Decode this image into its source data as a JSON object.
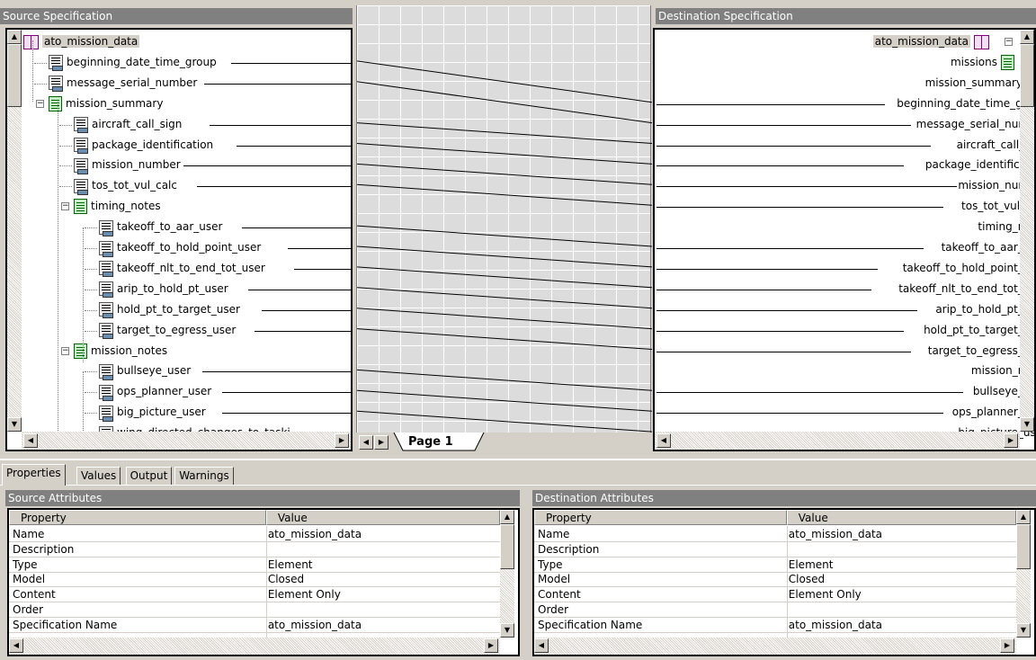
{
  "source_panel": {
    "title": "Source Specification",
    "items": [
      {
        "label": "ato_mission_data",
        "icon": "book-icon"
      },
      {
        "label": "beginning_date_time_group",
        "icon": "leaf-icon"
      },
      {
        "label": "message_serial_number",
        "icon": "leaf-icon"
      },
      {
        "label": "mission_summary",
        "icon": "node-icon"
      },
      {
        "label": "aircraft_call_sign",
        "icon": "leaf-icon"
      },
      {
        "label": "package_identification",
        "icon": "leaf-icon"
      },
      {
        "label": "mission_number",
        "icon": "leaf-icon"
      },
      {
        "label": "tos_tot_vul_calc",
        "icon": "leaf-icon"
      },
      {
        "label": "timing_notes",
        "icon": "node-icon"
      },
      {
        "label": "takeoff_to_aar_user",
        "icon": "leaf-icon"
      },
      {
        "label": "takeoff_to_hold_point_user",
        "icon": "leaf-icon"
      },
      {
        "label": "takeoff_nlt_to_end_tot_user",
        "icon": "leaf-icon"
      },
      {
        "label": "arip_to_hold_pt_user",
        "icon": "leaf-icon"
      },
      {
        "label": "hold_pt_to_target_user",
        "icon": "leaf-icon"
      },
      {
        "label": "target_to_egress_user",
        "icon": "leaf-icon"
      },
      {
        "label": "mission_notes",
        "icon": "node-icon"
      },
      {
        "label": "bullseye_user",
        "icon": "leaf-icon"
      },
      {
        "label": "ops_planner_user",
        "icon": "leaf-icon"
      },
      {
        "label": "big_picture_user",
        "icon": "leaf-icon"
      },
      {
        "label": "wing_directed_changes_to_taski",
        "icon": "leaf-icon"
      }
    ]
  },
  "destination_panel": {
    "title": "Destination Specification",
    "items": [
      {
        "label": "ato_mission_data",
        "icon": "book-icon"
      },
      {
        "label": "missions",
        "icon": "node-icon"
      },
      {
        "label": "mission_summary",
        "icon": "node-icon"
      },
      {
        "label": "beginning_date_time_group",
        "icon": "leaf-icon"
      },
      {
        "label": "message_serial_number",
        "icon": "leaf-icon"
      },
      {
        "label": "aircraft_call_sign",
        "icon": "leaf-icon"
      },
      {
        "label": "package_identification",
        "icon": "leaf-icon"
      },
      {
        "label": "mission_number",
        "icon": "leaf-icon"
      },
      {
        "label": "tos_tot_vul_calc",
        "icon": "leaf-icon"
      },
      {
        "label": "timing_notes",
        "icon": "node-icon"
      },
      {
        "label": "takeoff_to_aar_user",
        "icon": "leaf-icon"
      },
      {
        "label": "takeoff_to_hold_point_user",
        "icon": "leaf-icon"
      },
      {
        "label": "takeoff_nlt_to_end_tot_user",
        "icon": "leaf-icon"
      },
      {
        "label": "arip_to_hold_pt_user",
        "icon": "leaf-icon"
      },
      {
        "label": "hold_pt_to_target_user",
        "icon": "leaf-icon"
      },
      {
        "label": "target_to_egress_user",
        "icon": "leaf-icon"
      },
      {
        "label": "mission_notes",
        "icon": "node-icon"
      },
      {
        "label": "bullseye_user",
        "icon": "leaf-icon"
      },
      {
        "label": "ops_planner_user",
        "icon": "leaf-icon"
      },
      {
        "label": "big_picture_user",
        "icon": "leaf-icon"
      }
    ]
  },
  "mapping": {
    "page_tab_label": "Page 1"
  },
  "tabs": [
    "Properties",
    "Values",
    "Output",
    "Warnings"
  ],
  "source_attributes": {
    "title": "Source Attributes",
    "columns": [
      "Property",
      "Value"
    ],
    "rows": [
      [
        "Name",
        "ato_mission_data"
      ],
      [
        "Description",
        ""
      ],
      [
        "Type",
        "Element"
      ],
      [
        "Model",
        "Closed"
      ],
      [
        "Content",
        "Element Only"
      ],
      [
        "Order",
        ""
      ],
      [
        "Specification Name",
        "ato_mission_data"
      ]
    ]
  },
  "destination_attributes": {
    "title": "Destination Attributes",
    "columns": [
      "Property",
      "Value"
    ],
    "rows": [
      [
        "Name",
        "ato_mission_data"
      ],
      [
        "Description",
        ""
      ],
      [
        "Type",
        "Element"
      ],
      [
        "Model",
        "Closed"
      ],
      [
        "Content",
        "Element Only"
      ],
      [
        "Order",
        ""
      ],
      [
        "Specification Name",
        "ato_mission_data"
      ]
    ]
  }
}
